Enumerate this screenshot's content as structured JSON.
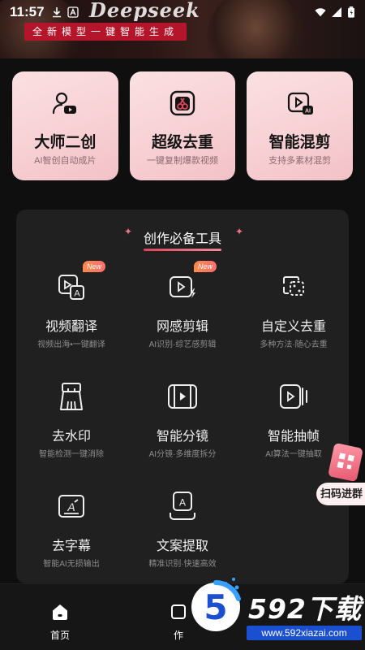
{
  "banner": {
    "brand": "Deepseek",
    "slogan": "全新模型一键智能生成"
  },
  "status": {
    "time": "11:57"
  },
  "cards": [
    {
      "title": "大师二创",
      "subtitle": "AI智创自动成片",
      "icon": "user-video-icon"
    },
    {
      "title": "超级去重",
      "subtitle": "一键复制爆款视频",
      "icon": "scissors-icon"
    },
    {
      "title": "智能混剪",
      "subtitle": "支持多素材混剪",
      "icon": "ai-video-icon"
    }
  ],
  "tools_panel": {
    "title": "创作必备工具",
    "tools": [
      {
        "name": "视频翻译",
        "desc": "视频出海•一键翻译",
        "badge": "New",
        "icon": "translate-icon"
      },
      {
        "name": "网感剪辑",
        "desc": "AI识别·综艺感剪辑",
        "badge": "New",
        "icon": "flash-video-icon"
      },
      {
        "name": "自定义去重",
        "desc": "多种方法·随心去重",
        "badge": "",
        "icon": "custom-dedup-icon"
      },
      {
        "name": "去水印",
        "desc": "智能检测一键消除",
        "badge": "",
        "icon": "broom-icon"
      },
      {
        "name": "智能分镜",
        "desc": "AI分镜·多维度拆分",
        "badge": "",
        "icon": "storyboard-icon"
      },
      {
        "name": "智能抽帧",
        "desc": "AI算法一键抽取",
        "badge": "",
        "icon": "frame-extract-icon"
      },
      {
        "name": "去字幕",
        "desc": "智能AI无损输出",
        "badge": "",
        "icon": "remove-subtitle-icon"
      },
      {
        "name": "文案提取",
        "desc": "精准识别·快速高效",
        "badge": "",
        "icon": "text-extract-icon"
      }
    ]
  },
  "scan_button": {
    "label": "扫码进群"
  },
  "bottom_nav": {
    "items": [
      {
        "label": "首页",
        "active": true
      },
      {
        "label": "作"
      }
    ]
  },
  "watermark": {
    "text": "592下载",
    "url": "www.592xiazai.com",
    "logo_digit": "5"
  },
  "colors": {
    "card_bg": "#f7cfd3",
    "panel_bg": "#202021",
    "accent": "#e04459",
    "badge": "#ff7a5c"
  }
}
